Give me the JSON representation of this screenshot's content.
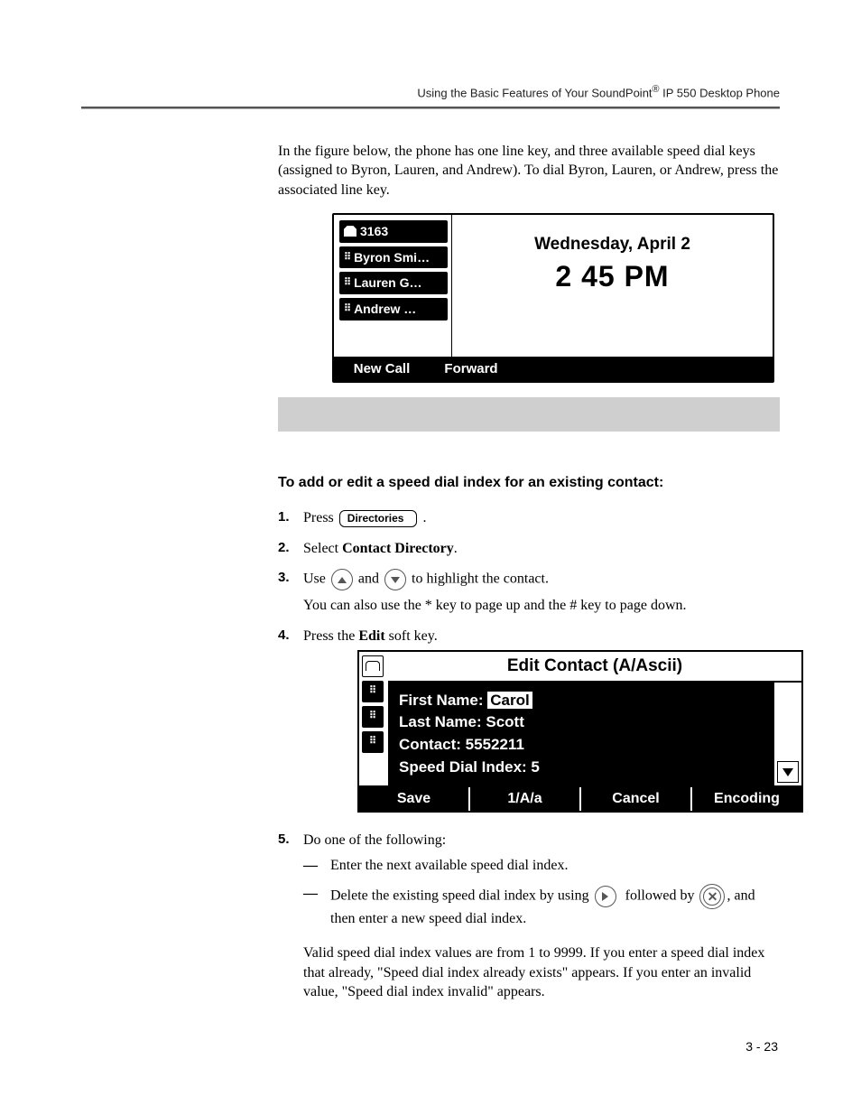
{
  "header": {
    "running_head_pre": "Using the Basic Features of Your SoundPoint",
    "running_head_sup": "®",
    "running_head_post": " IP 550 Desktop Phone"
  },
  "intro_para": "In the figure below, the phone has one line key, and three available speed dial keys (assigned to Byron, Lauren, and Andrew). To dial Byron, Lauren, or Andrew, press the associated line key.",
  "fig1": {
    "line_number": "3163",
    "keys": [
      "Byron Smi…",
      "Lauren G…",
      "Andrew …"
    ],
    "date": "Wednesday, April 2",
    "time": "2 45 PM",
    "softkeys": [
      "New Call",
      "Forward"
    ]
  },
  "section_title": "To add or edit a speed dial index for an existing contact:",
  "steps": {
    "s1_press": "Press",
    "s1_button": "Directories",
    "s1_end": ".",
    "s2_pre": "Select ",
    "s2_bold": "Contact Directory",
    "s2_post": ".",
    "s3_use": "Use",
    "s3_and": "and",
    "s3_post": "to highlight the contact.",
    "s3_note": "You can also use the * key to page up and the # key to page down.",
    "s4_pre": "Press the ",
    "s4_bold": "Edit",
    "s4_post": " soft key.",
    "s5_intro": "Do one of the following:",
    "s5_a": "Enter the next available speed dial index.",
    "s5_b_pre": "Delete the existing speed dial index by using",
    "s5_b_mid": "followed by",
    "s5_b_post": ", and then enter a new speed dial index.",
    "s5_valid": "Valid speed dial index values are from 1 to 9999. If you enter a speed dial index that already, \"Speed dial index already exists\" appears. If you enter an invalid value, \"Speed dial index invalid\" appears."
  },
  "fig2": {
    "title": "Edit Contact (A/Ascii)",
    "first_label": "First Name:",
    "first_value": "Carol",
    "last": "Last Name: Scott",
    "contact": "Contact: 5552211",
    "sdi": "Speed Dial Index: 5",
    "softkeys": [
      "Save",
      "1/A/a",
      "Cancel",
      "Encoding"
    ]
  },
  "page_num": "3 - 23"
}
